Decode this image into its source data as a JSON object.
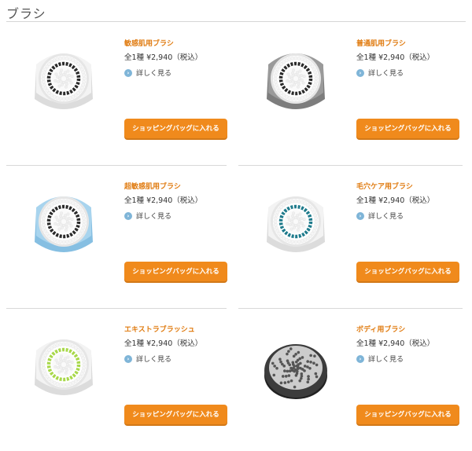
{
  "page": {
    "title": "ブラシ"
  },
  "products": [
    {
      "name": "敏感肌用ブラシ",
      "price": "全1種 ¥2,940（税込）",
      "detail_label": "詳しく見る",
      "cart_label": "ショッピングバッグに入れる",
      "colors": {
        "base": "#f3f3f3",
        "rim": "#dcdcdc",
        "bristle": "#ffffff",
        "ring": "#2a2a2a"
      }
    },
    {
      "name": "普通肌用ブラシ",
      "price": "全1種 ¥2,940（税込）",
      "detail_label": "詳しく見る",
      "cart_label": "ショッピングバッグに入れる",
      "colors": {
        "base": "#9a9a9a",
        "rim": "#7d7d7d",
        "bristle": "#ffffff",
        "ring": "#2a2a2a"
      }
    },
    {
      "name": "超敏感肌用ブラシ",
      "price": "全1種 ¥2,940（税込）",
      "detail_label": "詳しく見る",
      "cart_label": "ショッピングバッグに入れる",
      "colors": {
        "base": "#a8d4ee",
        "rim": "#86bfe2",
        "bristle": "#ffffff",
        "ring": "#2a2a2a"
      }
    },
    {
      "name": "毛穴ケア用ブラシ",
      "price": "全1種 ¥2,940（税込）",
      "detail_label": "詳しく見る",
      "cart_label": "ショッピングバッグに入れる",
      "colors": {
        "base": "#f3f3f3",
        "rim": "#dcdcdc",
        "bristle": "#ffffff",
        "ring": "#1f7b8c"
      }
    },
    {
      "name": "エキストラブラッシュ",
      "price": "全1種 ¥2,940（税込）",
      "detail_label": "詳しく見る",
      "cart_label": "ショッピングバッグに入れる",
      "colors": {
        "base": "#f3f3f3",
        "rim": "#dcdcdc",
        "bristle": "#ffffff",
        "ring": "#a8d84a"
      }
    },
    {
      "name": "ボディ用ブラシ",
      "price": "全1種 ¥2,940（税込）",
      "detail_label": "詳しく見る",
      "cart_label": "ショッピングバッグに入れる",
      "colors": {
        "base": "#3c3c3c",
        "rim": "#222222",
        "bristle": "#eeeeee",
        "ring": "#cccccc"
      }
    }
  ]
}
